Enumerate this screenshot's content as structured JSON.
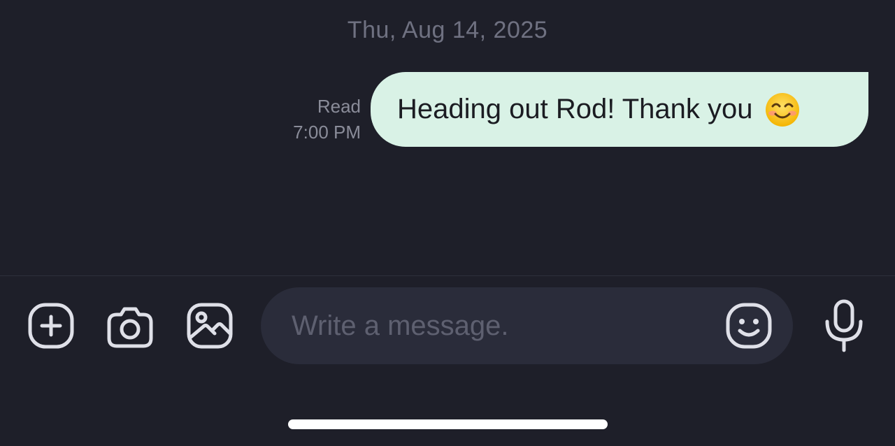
{
  "conversation": {
    "date_separator": "Thu, Aug 14, 2025",
    "messages": [
      {
        "direction": "outgoing",
        "text": "Heading out Rod! Thank you",
        "emoji": "smiling-face-with-smiling-eyes",
        "status": "Read",
        "time": "7:00 PM"
      }
    ]
  },
  "composer": {
    "placeholder": "Write a message.",
    "value": "",
    "icons": {
      "add": "plus-square-icon",
      "camera": "camera-icon",
      "gallery": "image-icon",
      "emoji": "smiley-face-icon",
      "mic": "microphone-icon"
    }
  },
  "colors": {
    "background": "#1e1f29",
    "outgoing_bubble": "#d9f2e6",
    "input_background": "#2a2c3a",
    "icon": "#dfe0e8",
    "muted_text": "#6f7181"
  }
}
